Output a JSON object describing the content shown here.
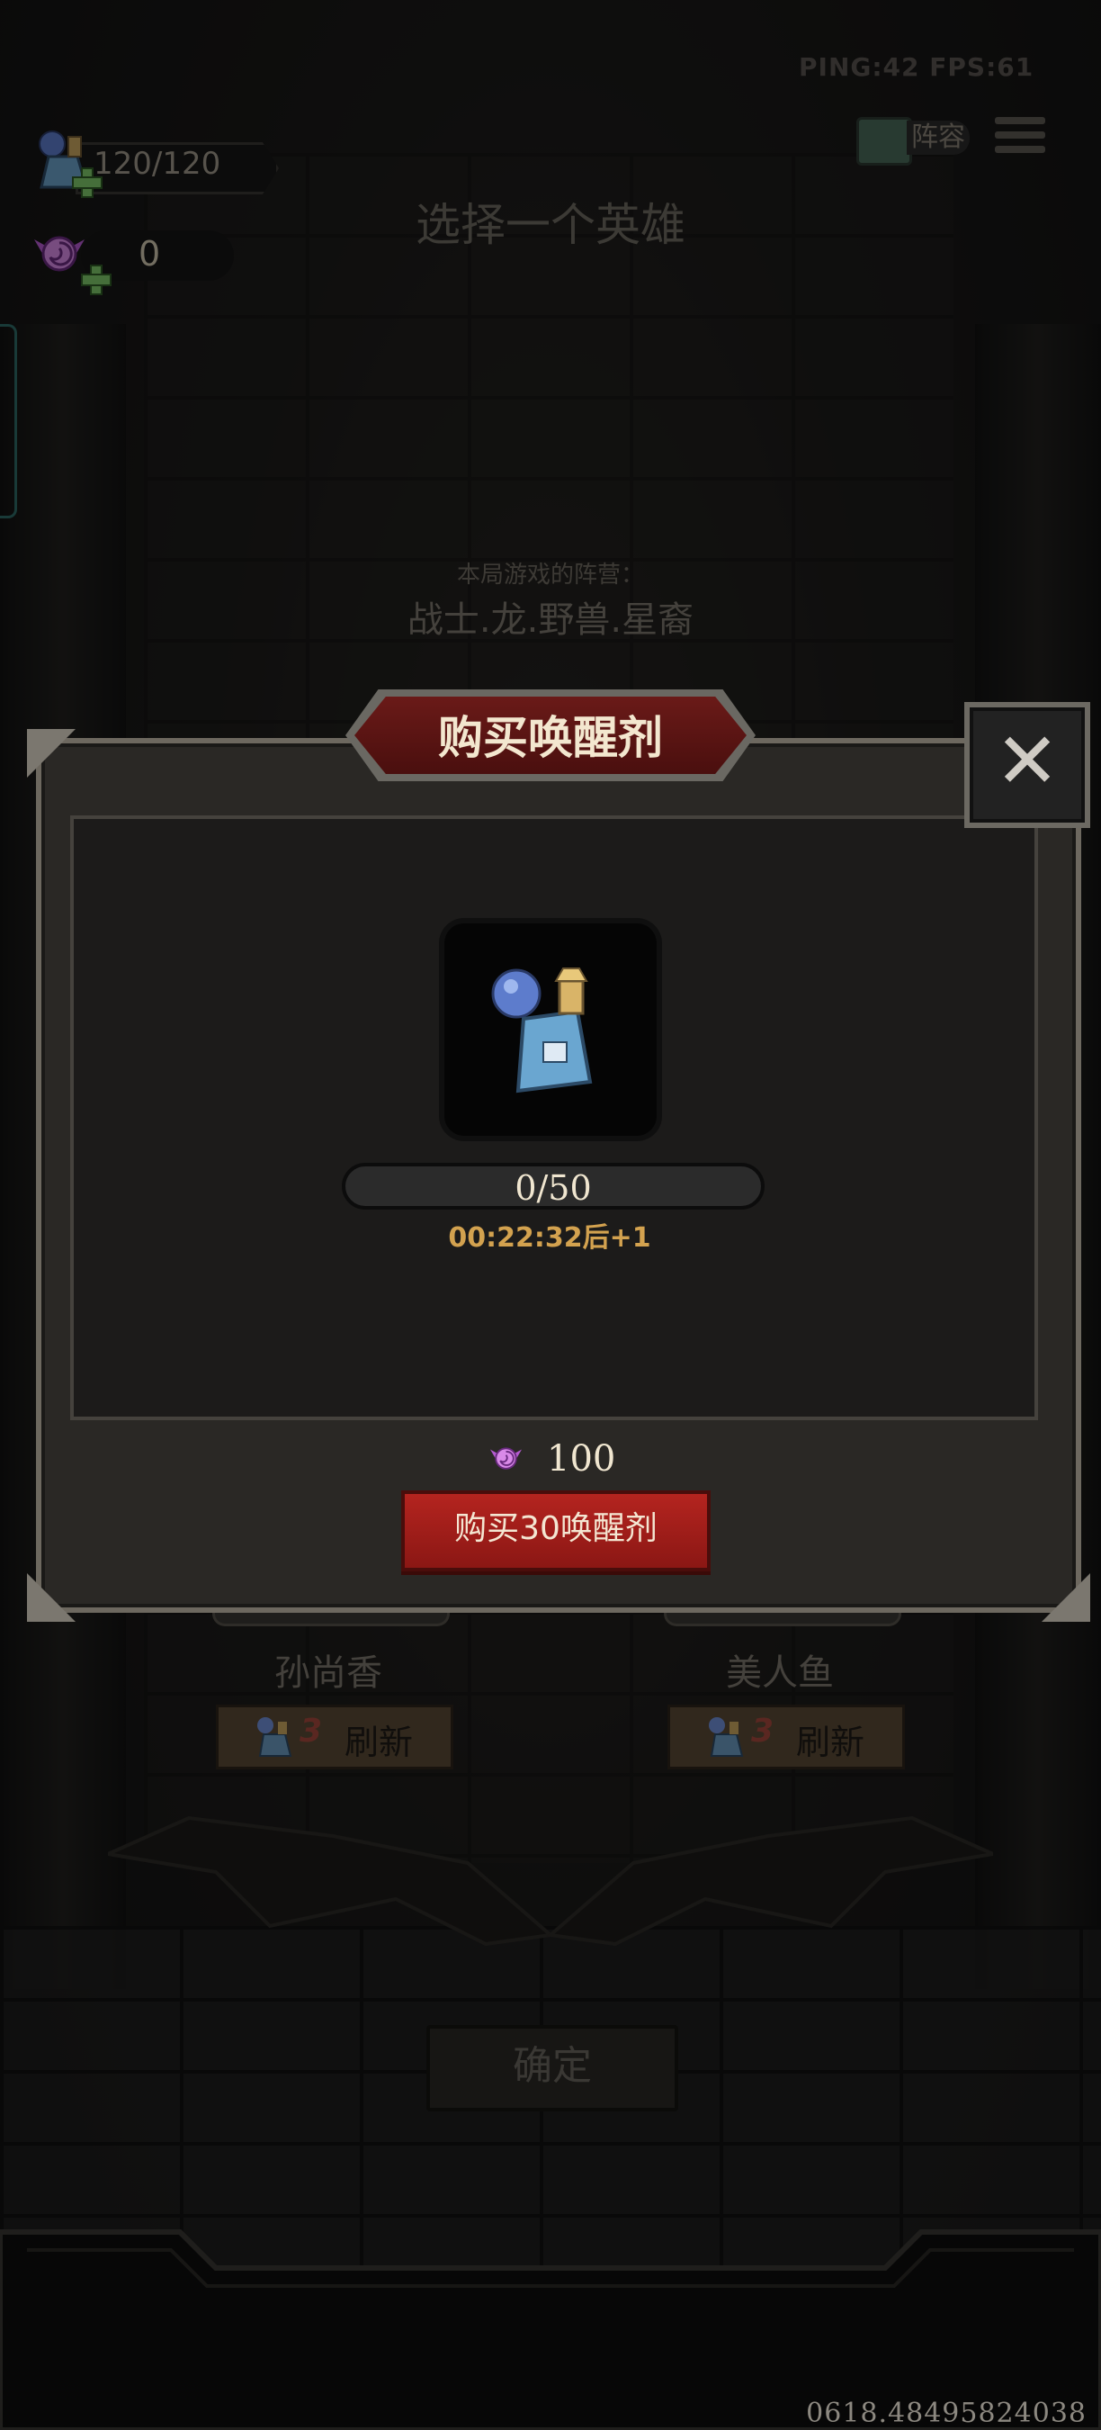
{
  "hud": {
    "ping_fps": "PING:42  FPS:61",
    "lineup_label": "阵容",
    "stamina": "120/120",
    "candy_count": "0"
  },
  "page": {
    "title": "选择一个英雄",
    "faction_label": "本局游戏的阵营：",
    "faction_value": "战士.龙.野兽.星裔"
  },
  "heroes": [
    {
      "name": "孙尚香",
      "refresh_cost": "3",
      "refresh_label": "刷新"
    },
    {
      "name": "美人鱼",
      "refresh_cost": "3",
      "refresh_label": "刷新"
    }
  ],
  "confirm_label": "确定",
  "modal": {
    "title": "购买唤醒剂",
    "close_label": "✕",
    "item_icon": "awakening-potion-icon",
    "progress_text": "0/50",
    "progress_fraction": 0,
    "timer_text": "00:22:32后+1",
    "price": "100",
    "price_icon": "candy-icon",
    "buy_label": "购买30唤醒剂"
  },
  "build_id": "0618.48495824038",
  "colors": {
    "buy_button": "#b4241f",
    "title_plate": "#6a1a18",
    "timer": "#d3a24f",
    "refresh_button": "#5a4a36"
  }
}
